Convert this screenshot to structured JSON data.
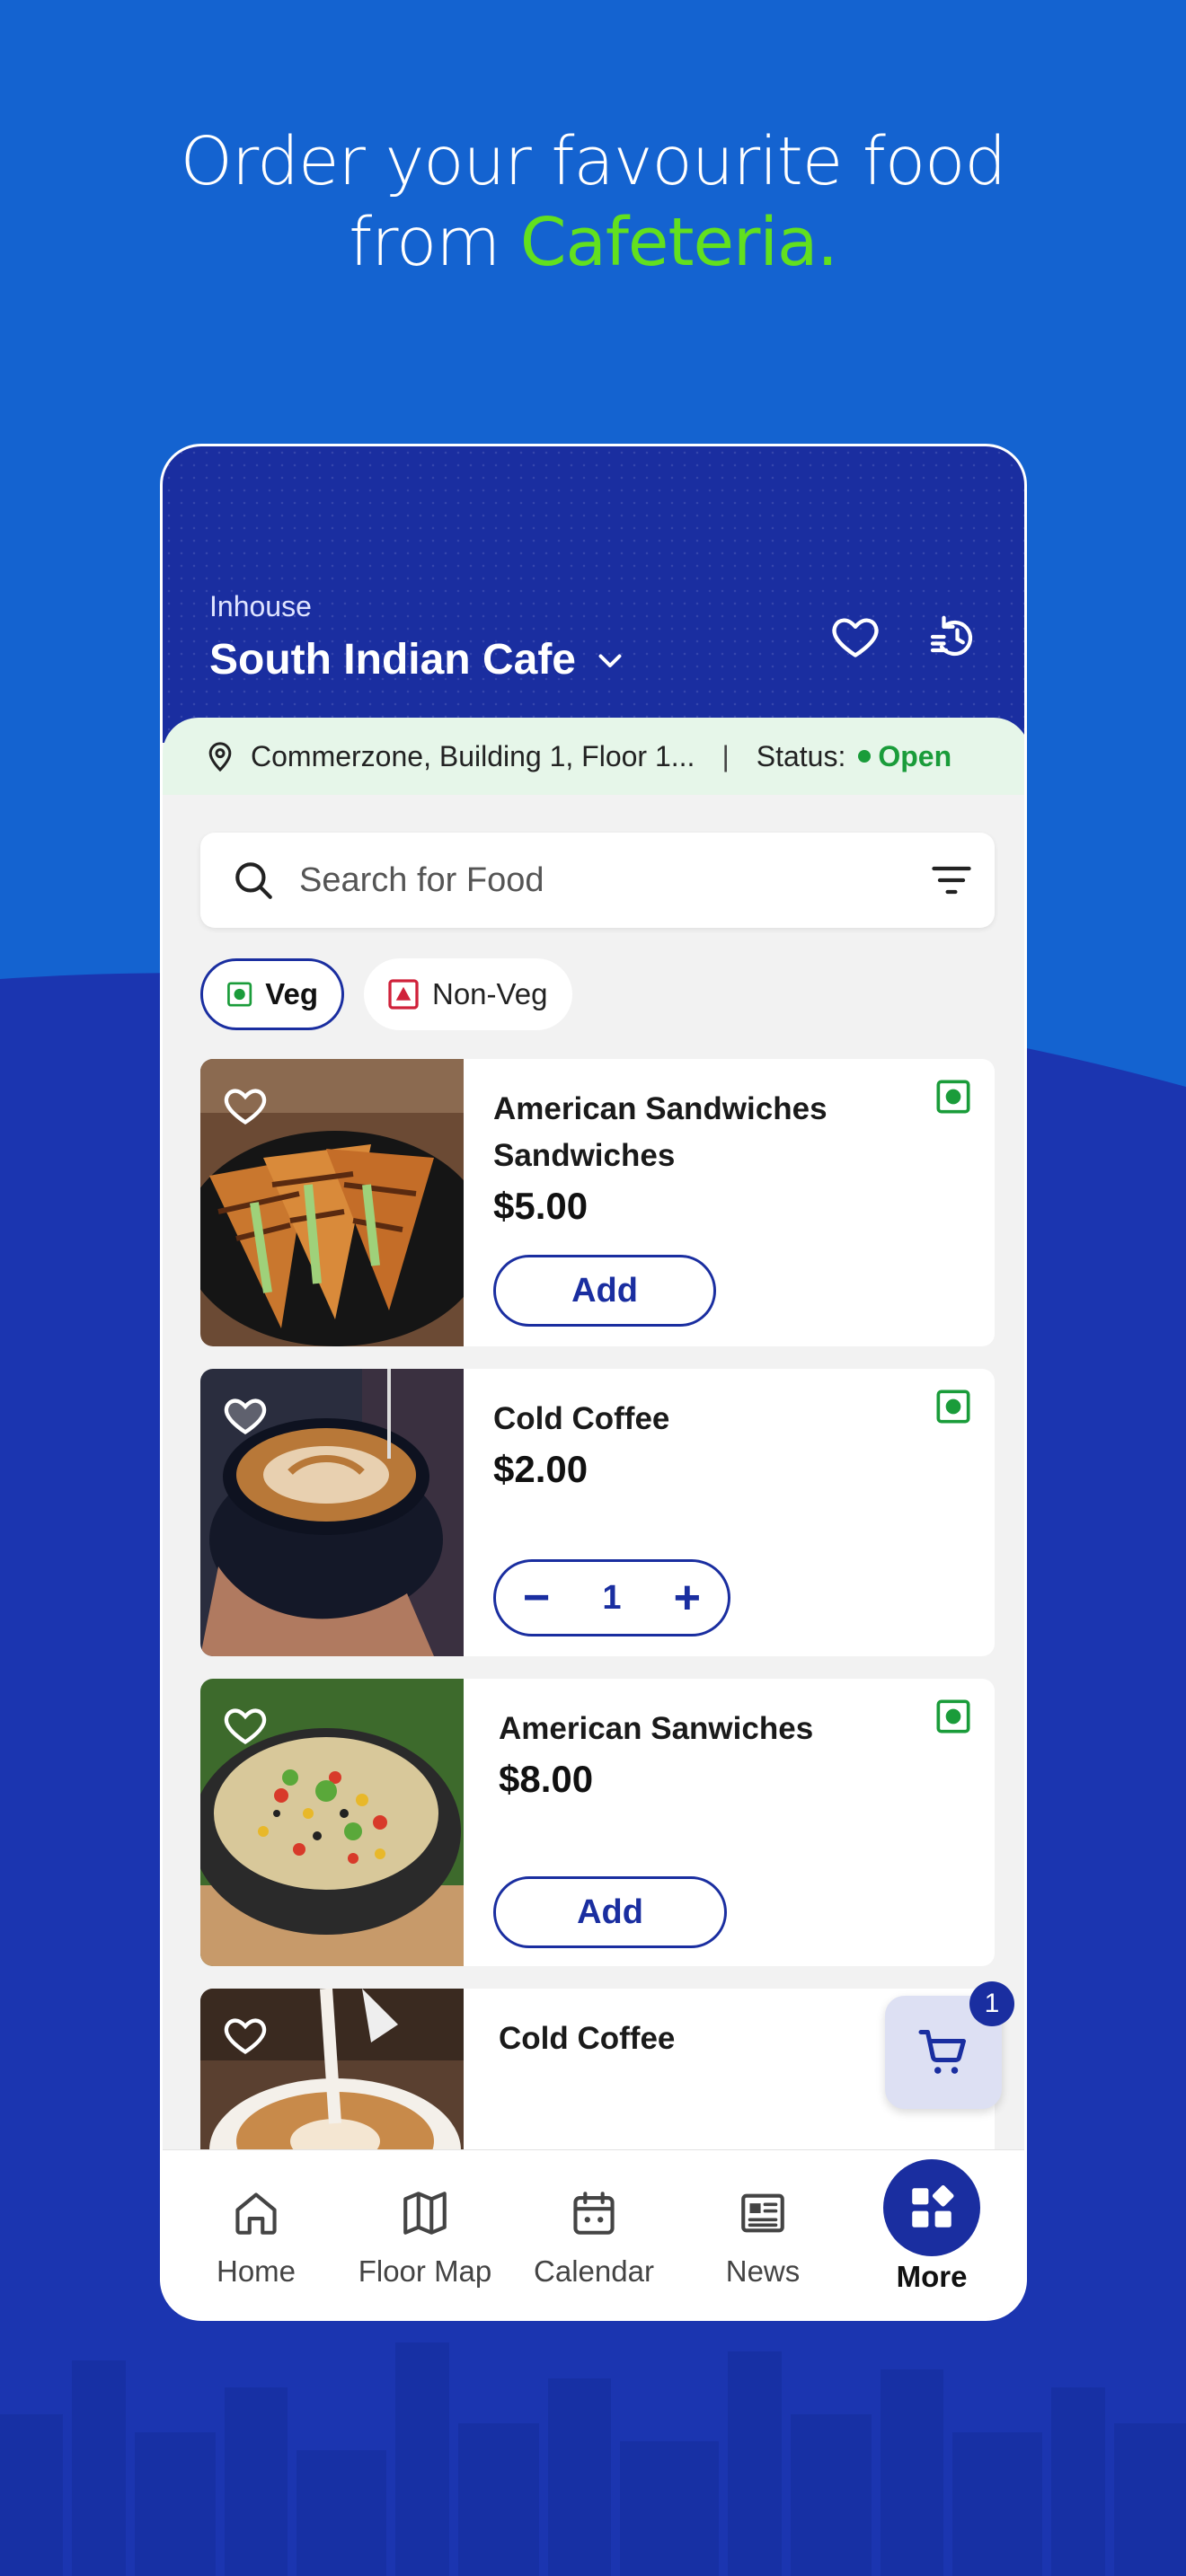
{
  "headline": {
    "line1": "Order your favourite food",
    "line2_prefix": "from ",
    "line2_accent": "Cafeteria."
  },
  "colors": {
    "brand": "#1a2ea0",
    "accent": "#62e01e",
    "open": "#1a9c3a",
    "veg": "#1a9c3a",
    "nonveg": "#d0213a"
  },
  "header": {
    "subtitle": "Inhouse",
    "cafe": "South Indian Cafe",
    "icons": [
      "heart-icon",
      "order-history-icon"
    ]
  },
  "location": {
    "address": "Commerzone, Building 1, Floor 1...",
    "separator": "|",
    "status_label": "Status:",
    "status_value": "Open"
  },
  "search": {
    "placeholder": "Search for Food"
  },
  "filters": [
    {
      "label": "Veg",
      "selected": true
    },
    {
      "label": "Non-Veg",
      "selected": false
    }
  ],
  "items": [
    {
      "title": "American Sandwiches Sandwiches",
      "price": "$5.00",
      "action": "Add",
      "type": "veg"
    },
    {
      "title": "Cold Coffee",
      "price": "$2.00",
      "quantity": "1",
      "type": "veg"
    },
    {
      "title": "American Sanwiches",
      "price": "$8.00",
      "action": "Add",
      "type": "veg"
    },
    {
      "title": "Cold Coffee",
      "price": "",
      "type": "veg"
    }
  ],
  "cart": {
    "count": "1"
  },
  "nav": [
    {
      "label": "Home",
      "icon": "home-icon"
    },
    {
      "label": "Floor Map",
      "icon": "map-icon"
    },
    {
      "label": "Calendar",
      "icon": "calendar-icon"
    },
    {
      "label": "News",
      "icon": "news-icon"
    },
    {
      "label": "More",
      "icon": "grid-icon",
      "active": true
    }
  ]
}
